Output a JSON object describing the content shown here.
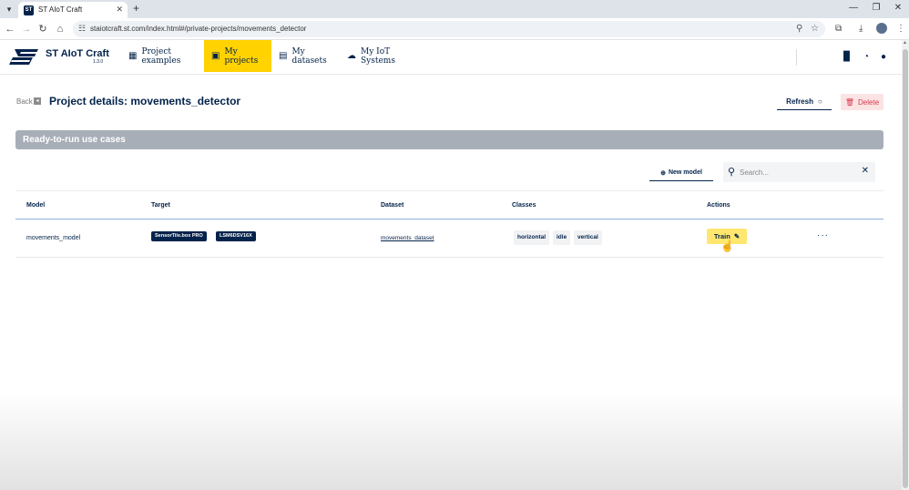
{
  "browser": {
    "tab_title": "ST AIoT Craft",
    "tab_favicon": "ST",
    "url": "staiotcraft.st.com/index.html#/private-projects/movements_detector",
    "new_tab": "+",
    "close_tab": "✕"
  },
  "app": {
    "name": "ST AIoT Craft",
    "version": "1.3.0",
    "nav": [
      {
        "label": "Project examples",
        "icon": "grid-icon"
      },
      {
        "label": "My projects",
        "icon": "folder-icon"
      },
      {
        "label": "My datasets",
        "icon": "chart-icon"
      },
      {
        "label": "My IoT Systems",
        "icon": "cloud-icon"
      }
    ]
  },
  "page": {
    "back_label": "Back",
    "title": "Project details: movements_detector",
    "refresh_label": "Refresh",
    "delete_label": "Delete",
    "section_title": "Ready-to-run use cases",
    "new_model_label": "New model",
    "search_placeholder": "Search..."
  },
  "table": {
    "headers": [
      "Model",
      "Target",
      "Dataset",
      "Classes",
      "Actions"
    ],
    "rows": [
      {
        "model": "movements_model",
        "targets": [
          "SensorTile.box PRO",
          "LSM6DSV16X"
        ],
        "dataset": "movements_dataset",
        "classes": [
          "horizontal",
          "idle",
          "vertical"
        ],
        "action_label": "Train",
        "more": "···"
      }
    ]
  },
  "colors": {
    "brand_dark": "#03234b",
    "accent_yellow": "#ffd200",
    "train_yellow": "#ffe66e",
    "delete_red": "#d4384a",
    "section_gray": "#a8aeb8"
  }
}
